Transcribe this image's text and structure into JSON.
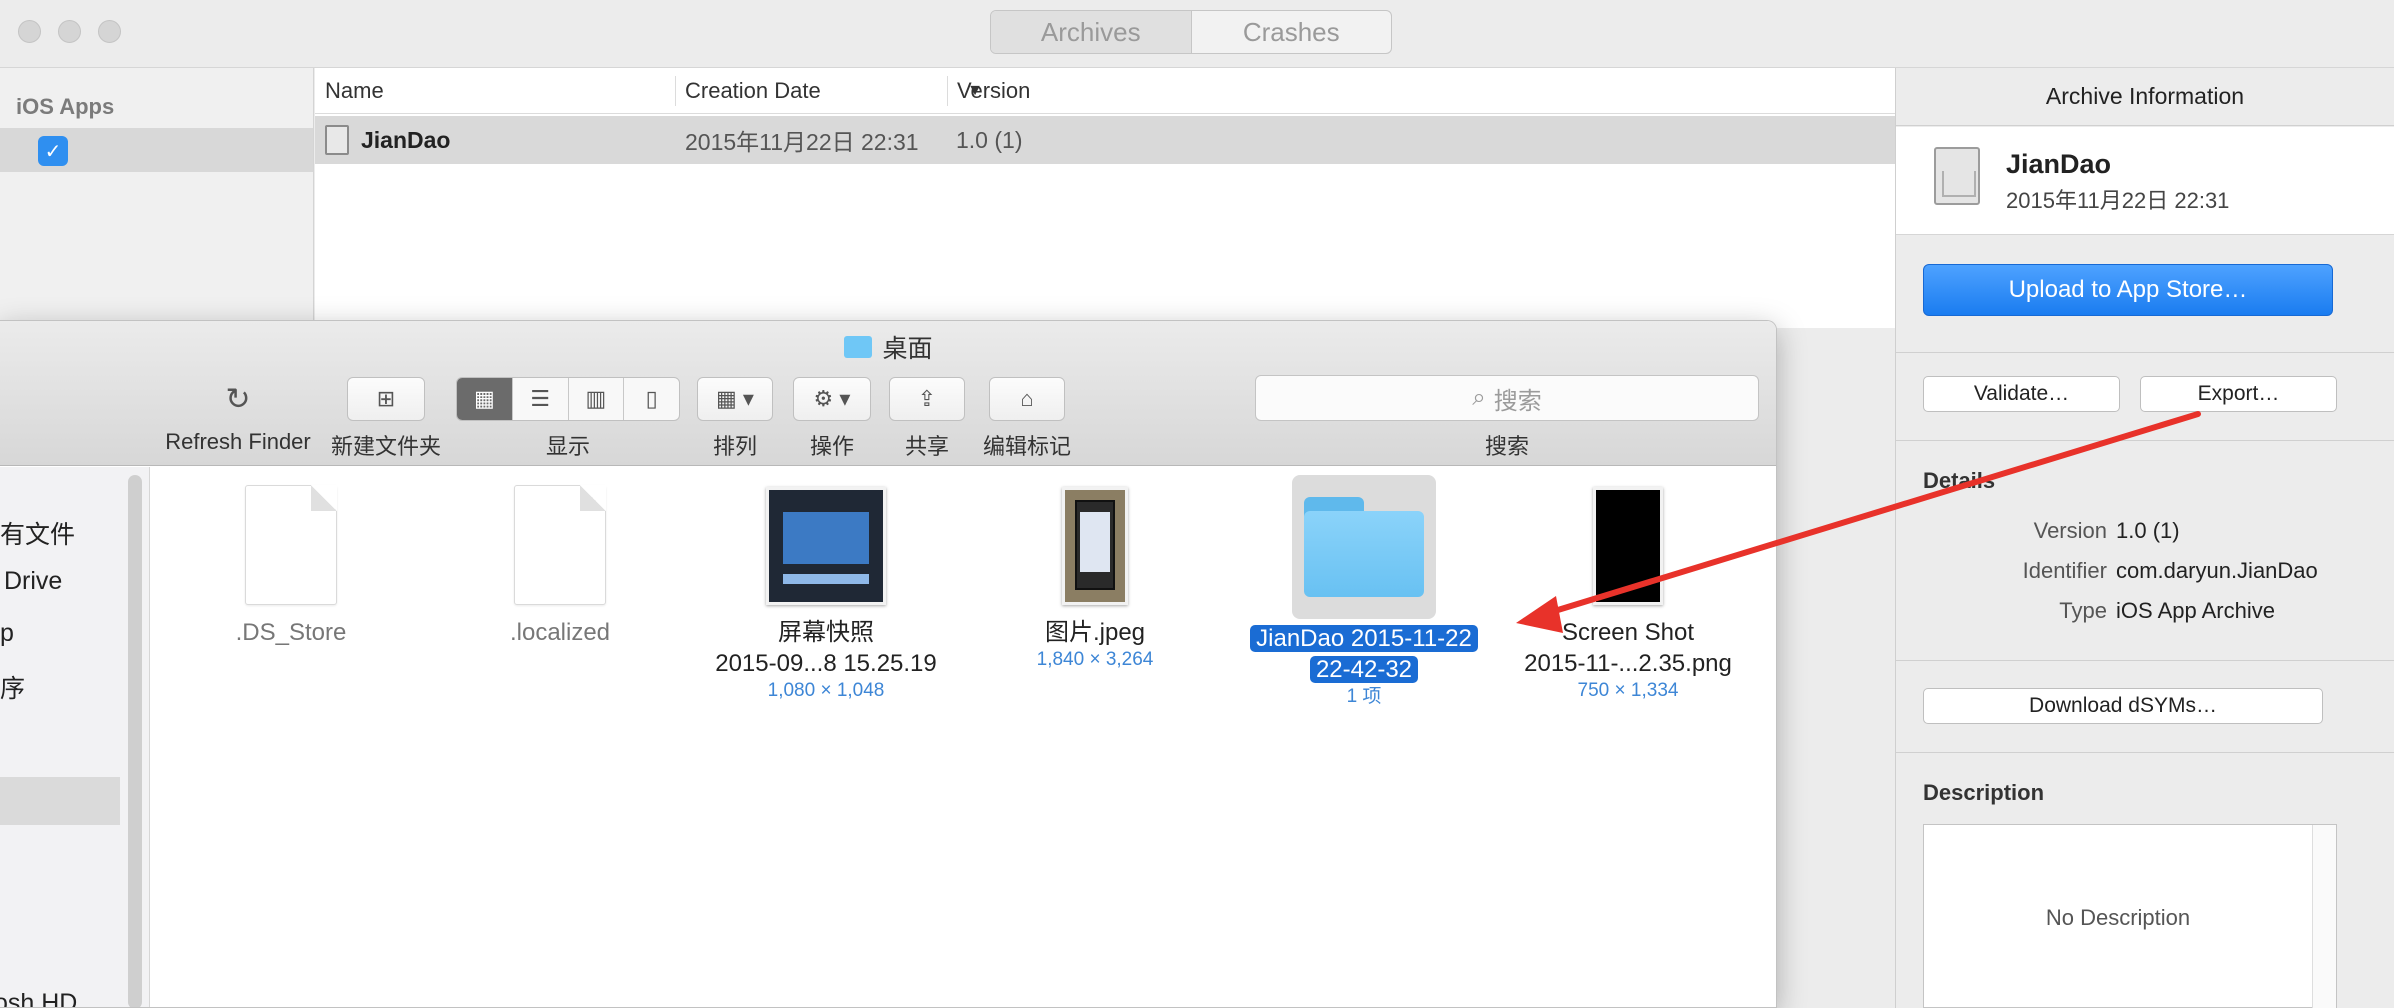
{
  "organizer": {
    "tabs": [
      "Archives",
      "Crashes"
    ],
    "sidebar_header": "iOS Apps",
    "table": {
      "columns": [
        "Name",
        "Creation Date",
        "Version"
      ],
      "rows": [
        {
          "name": "JianDao",
          "date": "2015年11月22日 22:31",
          "version": "1.0 (1)"
        }
      ]
    }
  },
  "inspector": {
    "title": "Archive Information",
    "app_name": "JianDao",
    "app_date": "2015年11月22日 22:31",
    "upload": "Upload to App Store…",
    "validate": "Validate…",
    "export": "Export…",
    "details_header": "Details",
    "details": [
      {
        "key": "Version",
        "value": "1.0 (1)"
      },
      {
        "key": "Identifier",
        "value": "com.daryun.JianDao"
      },
      {
        "key": "Type",
        "value": "iOS App Archive"
      }
    ],
    "download": "Download dSYMs…",
    "description_header": "Description",
    "description_placeholder": "No Description"
  },
  "finder": {
    "title": "桌面",
    "toolbar": {
      "refresh": "Refresh Finder",
      "new_folder": "新建文件夹",
      "view": "显示",
      "arrange": "排列",
      "action": "操作",
      "share": "共享",
      "tags": "编辑标记",
      "search_label": "搜索",
      "search_placeholder": "搜索"
    },
    "sidebar": [
      "有文件",
      "Drive",
      "p",
      "序",
      "osh HD"
    ],
    "files": [
      {
        "name": ".DS_Store"
      },
      {
        "name": ".localized"
      },
      {
        "name1": "屏幕快照",
        "name2": "2015-09...8 15.25.19",
        "meta": "1,080 × 1,048"
      },
      {
        "name": "图片.jpeg",
        "meta": "1,840 × 3,264"
      },
      {
        "name1": "JianDao 2015-11-22",
        "name2": "22-42-32",
        "meta": "1 项"
      },
      {
        "name1": "Screen Shot",
        "name2": "2015-11-...2.35.png",
        "meta": "750 × 1,334"
      }
    ]
  },
  "colors": {
    "accent": "#1a7cf0",
    "selection": "#1a6cd4",
    "arrow": "#e8322a"
  }
}
